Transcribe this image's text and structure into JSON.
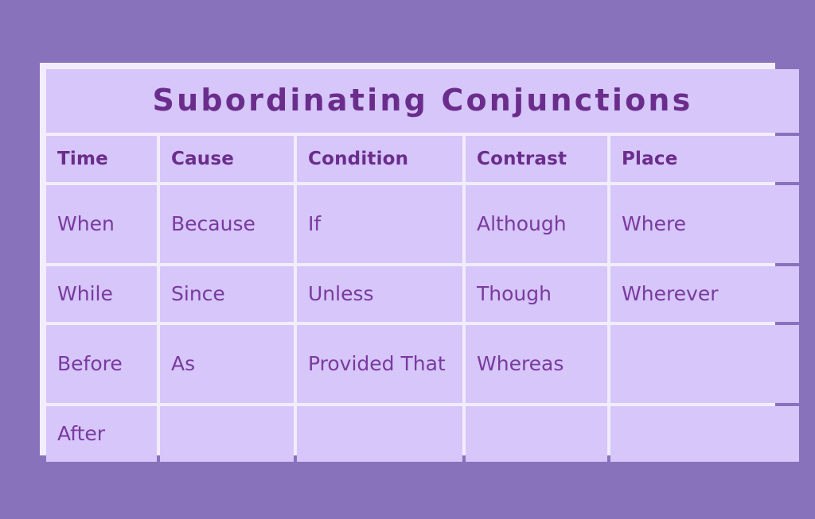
{
  "document": {
    "title": "Subordinating Conjunctions",
    "background_color": "#8872bc",
    "cell_color": "#d6c6fa",
    "grid_color": "#f2edfc",
    "heading_text_color": "#6b2d8c",
    "body_text_color": "#7a3a9e"
  },
  "table": {
    "headers": [
      "Time",
      "Cause",
      "Condition",
      "Contrast",
      "Place"
    ],
    "rows": [
      [
        "When",
        "Because",
        "If",
        "Although",
        "Where"
      ],
      [
        "While",
        "Since",
        "Unless",
        "Though",
        "Wherever"
      ],
      [
        "Before",
        "As",
        "Provided That",
        "Whereas",
        ""
      ],
      [
        "After",
        "",
        "",
        "",
        ""
      ]
    ]
  }
}
